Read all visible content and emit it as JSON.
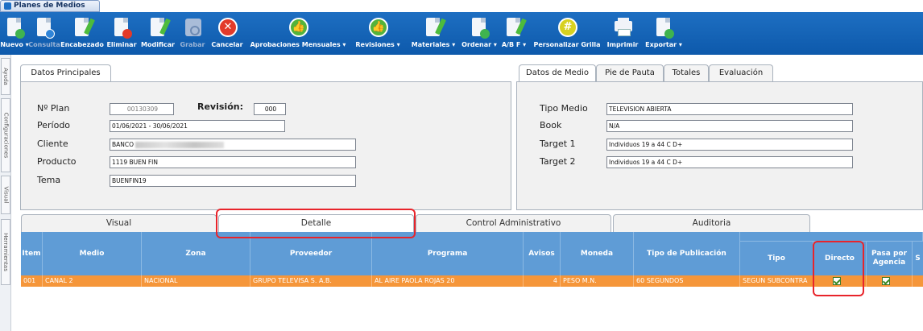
{
  "window": {
    "title": "Planes de Medios"
  },
  "toolbar": {
    "items": [
      {
        "label": "Nuevo ▾",
        "icon": "new-doc-icon",
        "enabled": true
      },
      {
        "label": "Consulta",
        "icon": "query-doc-icon",
        "enabled": false
      },
      {
        "label": "Encabezado",
        "icon": "header-edit-icon",
        "enabled": true
      },
      {
        "label": "Eliminar",
        "icon": "delete-doc-icon",
        "enabled": true
      },
      {
        "label": "Modificar",
        "icon": "modify-doc-icon",
        "enabled": true
      },
      {
        "label": "Grabar",
        "icon": "save-icon",
        "enabled": false
      },
      {
        "label": "Cancelar",
        "icon": "cancel-icon",
        "enabled": true
      },
      {
        "label": "Aprobaciones Mensuales ▾",
        "icon": "thumbs-up-icon",
        "enabled": true
      },
      {
        "label": "Revisiones ▾",
        "icon": "thumbs-up-icon",
        "enabled": true
      },
      {
        "label": "Materiales ▾",
        "icon": "materials-icon",
        "enabled": true
      },
      {
        "label": "Ordenar ▾",
        "icon": "order-icon",
        "enabled": true
      },
      {
        "label": "A/B F ▾",
        "icon": "ab-edit-icon",
        "enabled": true
      },
      {
        "label": "Personalizar Grilla",
        "icon": "globe-grid-icon",
        "enabled": true
      },
      {
        "label": "Imprimir",
        "icon": "printer-icon",
        "enabled": true
      },
      {
        "label": "Exportar ▾",
        "icon": "export-icon",
        "enabled": true
      }
    ]
  },
  "sidetabs": [
    "Ayuda",
    "Configuraciones",
    "Visual",
    "Herramientas"
  ],
  "principal": {
    "tab": "Datos Principales",
    "plan_label": "Nº Plan",
    "plan_value": "00130309",
    "revision_label": "Revisión:",
    "revision_value": "000",
    "periodo_label": "Período",
    "periodo_value": "01/06/2021 - 30/06/2021",
    "cliente_label": "Cliente",
    "cliente_value": "BANCO",
    "producto_label": "Producto",
    "producto_value": "1119 BUEN FIN",
    "tema_label": "Tema",
    "tema_value": "BUENFIN19"
  },
  "medio": {
    "tabs": [
      "Datos de Medio",
      "Pie de Pauta",
      "Totales",
      "Evaluación"
    ],
    "tipo_label": "Tipo Medio",
    "tipo_value": "TELEVISION ABIERTA",
    "book_label": "Book",
    "book_value": "N/A",
    "target1_label": "Target 1",
    "target1_value": "Individuos 19 a 44 C D+",
    "target2_label": "Target 2",
    "target2_value": "Individuos 19 a 44 C D+"
  },
  "bottom_tabs": [
    "Visual",
    "Detalle",
    "Control Administrativo",
    "Auditoria"
  ],
  "grid": {
    "headers": {
      "item": "Item",
      "medio": "Medio",
      "zona": "Zona",
      "proveedor": "Proveedor",
      "programa": "Programa",
      "avisos": "Avisos",
      "moneda": "Moneda",
      "tipo_pub": "Tipo de Publicación",
      "tipo": "Tipo",
      "directo": "Directo",
      "pasa": "Pasa por Agencia",
      "extra": "S"
    },
    "row": {
      "item": "001",
      "medio": "CANAL 2",
      "zona": "NACIONAL",
      "proveedor": "GRUPO TELEVISA S. A.B.",
      "programa": "AL AIRE PAOLA ROJAS 20",
      "avisos": "4",
      "moneda": "PESO M.N.",
      "tipo_pub": "60 SEGUNDOS",
      "tipo": "SEGUN SUBCONTRA",
      "directo": true,
      "pasa": true
    }
  }
}
